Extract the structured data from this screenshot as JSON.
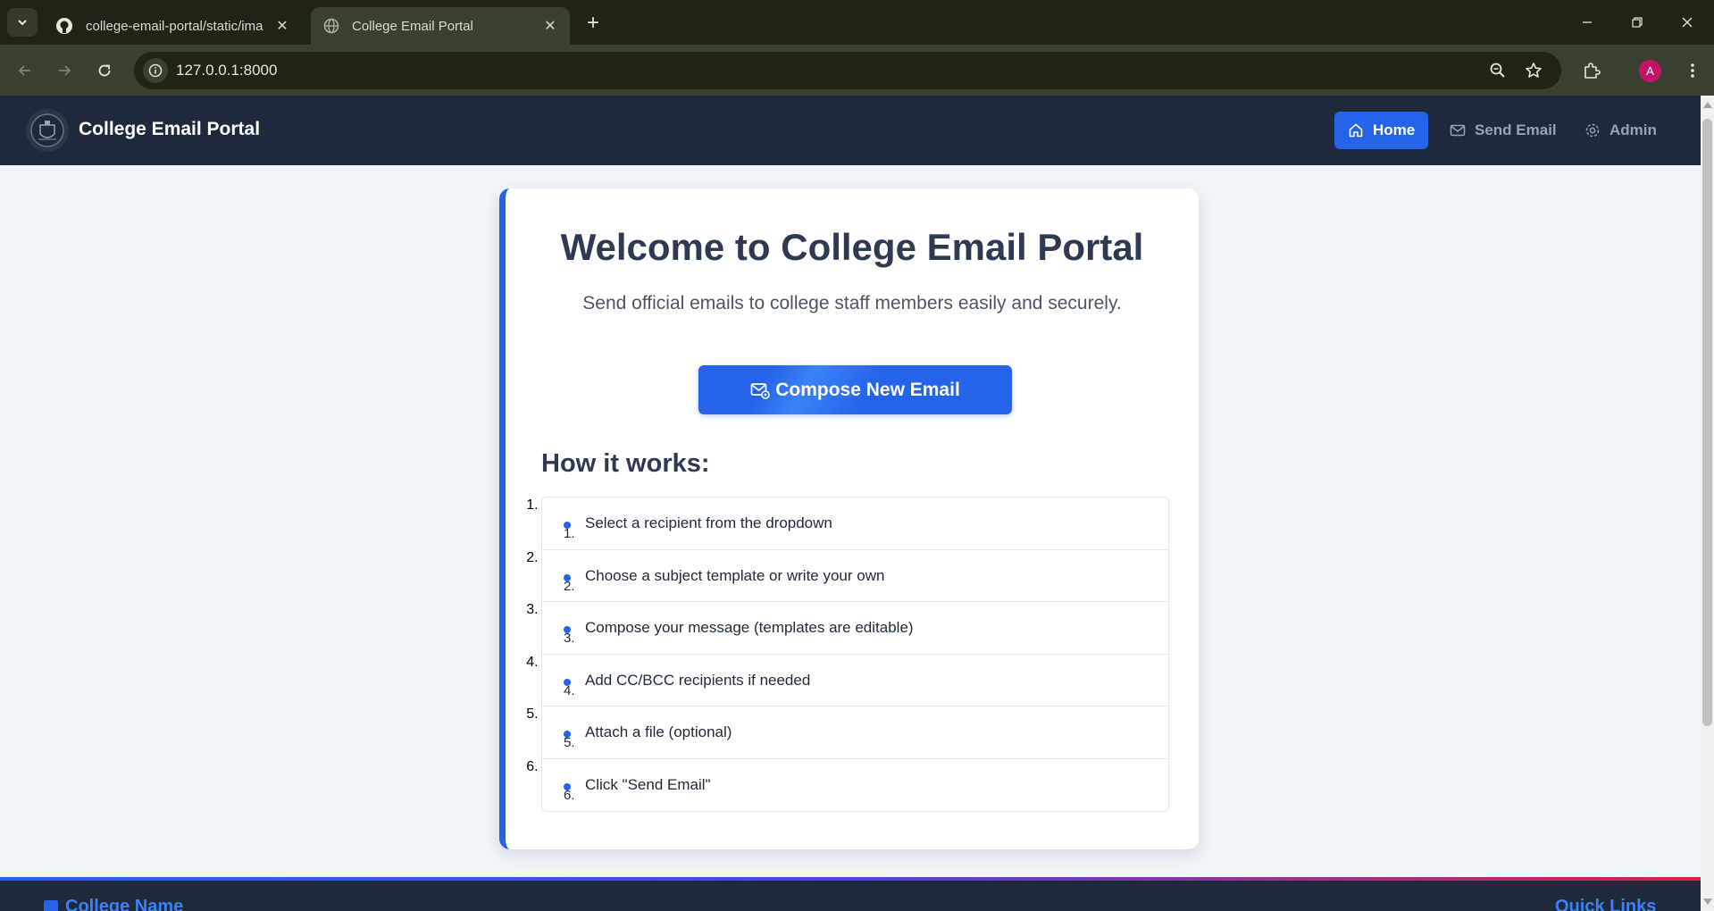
{
  "browser": {
    "tabs": [
      {
        "title": "college-email-portal/static/ima",
        "icon": "github-icon",
        "active": false
      },
      {
        "title": "College Email Portal",
        "icon": "globe-icon",
        "active": true
      }
    ],
    "url": "127.0.0.1:8000",
    "profile_initial": "A"
  },
  "navbar": {
    "brand": "College Email Portal",
    "links": [
      {
        "label": "Home",
        "icon": "home-icon",
        "active": true
      },
      {
        "label": "Send Email",
        "icon": "mail-icon",
        "active": false
      },
      {
        "label": "Admin",
        "icon": "gear-icon",
        "active": false
      }
    ]
  },
  "hero": {
    "title": "Welcome to College Email Portal",
    "subtitle": "Send official emails to college staff members easily and securely.",
    "cta_label": "Compose New Email"
  },
  "how_it_works": {
    "heading": "How it works:",
    "steps": [
      {
        "num": "1.",
        "text": "Select a recipient from the dropdown"
      },
      {
        "num": "2.",
        "text": "Choose a subject template or write your own"
      },
      {
        "num": "3.",
        "text": "Compose your message (templates are editable)"
      },
      {
        "num": "4.",
        "text": "Add CC/BCC recipients if needed"
      },
      {
        "num": "5.",
        "text": "Attach a file (optional)"
      },
      {
        "num": "6.",
        "text": "Click \"Send Email\""
      }
    ]
  },
  "footer": {
    "left_title": "College Name",
    "right_title": "Quick Links"
  },
  "colors": {
    "accent": "#2563eb",
    "navbar_bg": "#1e293b",
    "page_bg": "#f1f4f9"
  }
}
